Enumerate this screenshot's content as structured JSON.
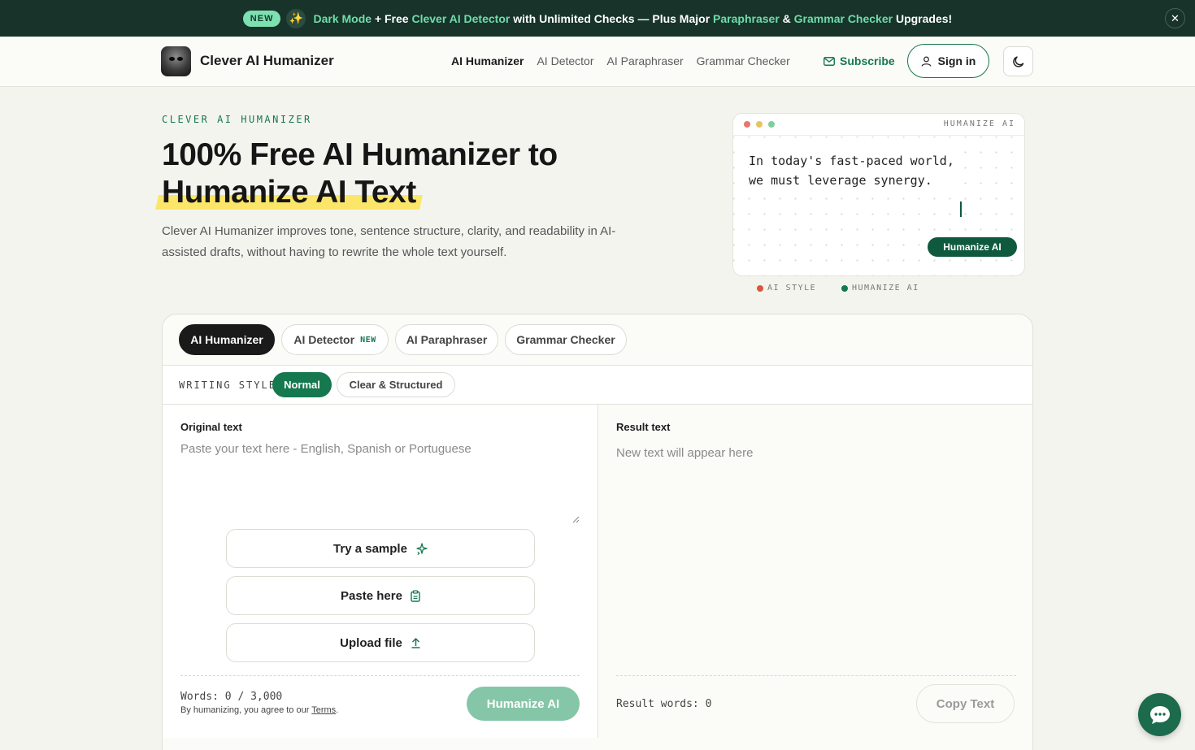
{
  "announcement": {
    "badge": "NEW",
    "sparkle_icon": "sparkles-icon",
    "dark_mode": "Dark Mode",
    "text1": "+ Free",
    "detector": "Clever AI Detector",
    "text2": "with Unlimited Checks — Plus Major",
    "paraphraser": "Paraphraser",
    "amp": "&",
    "grammar": "Grammar Checker",
    "text3": "Upgrades!",
    "close": "✕"
  },
  "nav": {
    "brand": "Clever AI Humanizer",
    "links": [
      "AI Humanizer",
      "AI Detector",
      "AI Paraphraser",
      "Grammar Checker"
    ],
    "subscribe": "Subscribe",
    "signin": "Sign in"
  },
  "hero": {
    "eyebrow": "CLEVER AI HUMANIZER",
    "title_line1": "100% Free AI Humanizer to",
    "title_line2": "Humanize AI Text",
    "description": "Clever AI Humanizer improves tone, sentence structure, clarity, and readability in AI-assisted drafts, without having to rewrite the whole text yourself."
  },
  "preview": {
    "label": "HUMANIZE AI",
    "text_line1": "In today's fast-paced world,",
    "text_line2": "we must leverage synergy.",
    "button": "Humanize AI",
    "legend_ai": "AI STYLE",
    "legend_human": "HUMANIZE AI",
    "colors": {
      "red": "#e6776e",
      "yellow": "#e8c55a",
      "green": "#7fcf9a",
      "legend_ai": "#d9563f",
      "legend_human": "#15784f"
    }
  },
  "tool": {
    "tabs": [
      {
        "label": "AI Humanizer",
        "badge": ""
      },
      {
        "label": "AI Detector",
        "badge": "NEW"
      },
      {
        "label": "AI Paraphraser",
        "badge": ""
      },
      {
        "label": "Grammar Checker",
        "badge": ""
      }
    ],
    "writing_style_label": "WRITING STYLE",
    "styles": [
      "Normal",
      "Clear & Structured"
    ],
    "original_title": "Original text",
    "original_placeholder": "Paste your text here - English, Spanish or Portuguese",
    "actions": {
      "sample": "Try a sample",
      "paste": "Paste here",
      "upload": "Upload file"
    },
    "words": "Words: 0 / 3,000",
    "terms_prefix": "By humanizing, you agree to our",
    "terms_link": "Terms",
    "terms_suffix": ".",
    "humanize_button": "Humanize AI",
    "result_title": "Result text",
    "result_placeholder": "New text will appear here",
    "result_words": "Result words: 0",
    "copy_button": "Copy Text"
  },
  "accent_color": "#15784f"
}
